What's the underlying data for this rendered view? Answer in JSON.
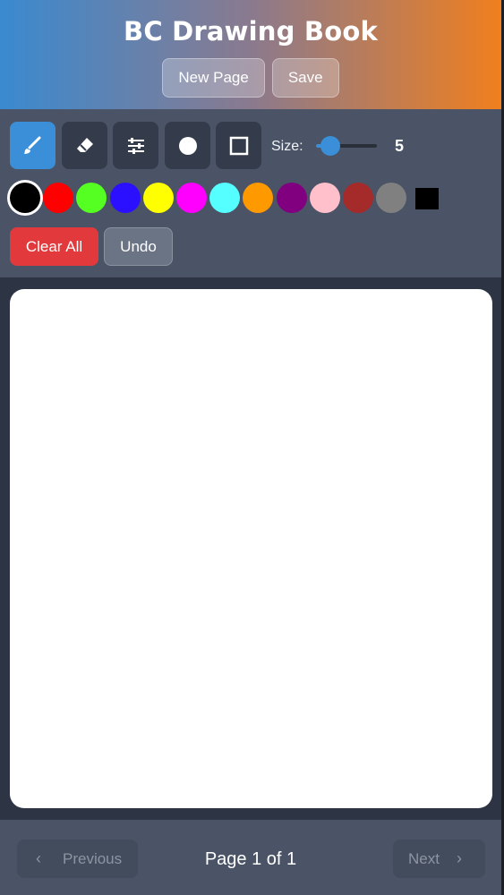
{
  "header": {
    "title": "BC Drawing Book",
    "new_page_label": "New Page",
    "save_label": "Save"
  },
  "toolbar": {
    "tools": [
      {
        "name": "brush",
        "icon": "brush-icon",
        "active": true
      },
      {
        "name": "eraser",
        "icon": "eraser-icon",
        "active": false
      },
      {
        "name": "settings",
        "icon": "sliders-icon",
        "active": false
      },
      {
        "name": "circle",
        "icon": "circle-icon",
        "active": false
      },
      {
        "name": "rectangle",
        "icon": "square-icon",
        "active": false
      }
    ],
    "size_label": "Size:",
    "size_value": "5",
    "size_fraction": 0.1,
    "clear_all_label": "Clear All",
    "undo_label": "Undo"
  },
  "palette": {
    "colors": [
      "#000000",
      "#ff0000",
      "#55ff22",
      "#2a10ff",
      "#ffff00",
      "#ff00ff",
      "#55ffff",
      "#ff9900",
      "#800080",
      "#ffc0cb",
      "#a52a2a",
      "#808080"
    ],
    "selected": "#000000",
    "custom_color": "#000000"
  },
  "footer": {
    "previous_label": "Previous",
    "next_label": "Next",
    "page_indicator": "Page 1 of 1"
  },
  "colors": {
    "accent": "#3b8fd8",
    "danger": "#e23a3c",
    "header_gradient_start": "#3a8ad0",
    "header_gradient_end": "#f07f1e"
  }
}
